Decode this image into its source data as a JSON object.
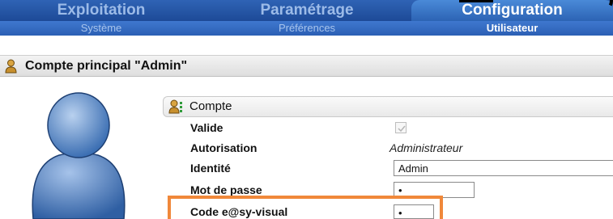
{
  "top_tabs": [
    {
      "label": "Exploitation",
      "active": false
    },
    {
      "label": "Paramétrage",
      "active": false
    },
    {
      "label": "Configuration",
      "active": true
    }
  ],
  "sub_tabs": [
    {
      "label": "Système",
      "active": false
    },
    {
      "label": "Préférences",
      "active": false
    },
    {
      "label": "Utilisateur",
      "active": true
    }
  ],
  "section": {
    "title": "Compte principal \"Admin\"",
    "icon": "user-icon"
  },
  "account_panel": {
    "title": "Compte",
    "icon": "user-settings-icon",
    "fields": {
      "valide": {
        "label": "Valide",
        "checked": true
      },
      "autorisation": {
        "label": "Autorisation",
        "value": "Administrateur"
      },
      "identite": {
        "label": "Identité",
        "value": "Admin"
      },
      "mot_de_passe": {
        "label": "Mot de passe",
        "value": "•"
      },
      "code": {
        "label": "Code e@sy-visual",
        "value": "•"
      }
    }
  },
  "colors": {
    "tab_bar": "#2f63b5",
    "active_tab": "#4a8ad8",
    "highlight": "#f0883a",
    "avatar": "#3b6fb2"
  }
}
